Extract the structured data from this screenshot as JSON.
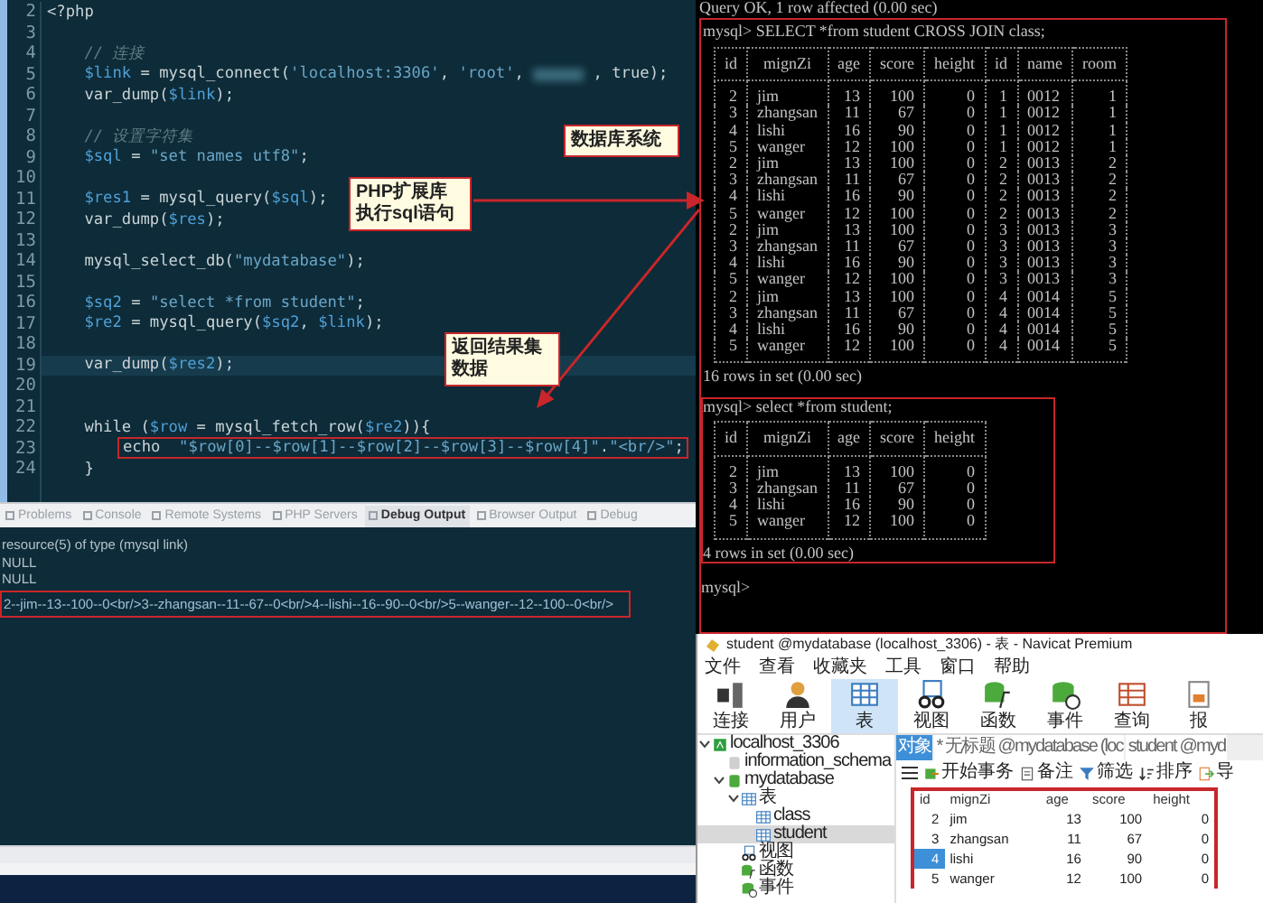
{
  "editor": {
    "lines": [
      {
        "number": "2",
        "current": false,
        "highlighted": false,
        "kind": "code",
        "text": "<?php"
      },
      {
        "number": "3",
        "current": false
      },
      {
        "number": "4",
        "current": false,
        "highlighted": false,
        "kind": "comment",
        "text": "    // 连接"
      },
      {
        "number": "5",
        "current": false,
        "highlighted": false,
        "kind": "code",
        "text": "    $link = mysql_connect('localhost:3306', 'root', ",
        "blurred": true,
        "after": " , true);"
      },
      {
        "number": "6",
        "current": false,
        "highlighted": false,
        "kind": "code",
        "text": "    var_dump($link);"
      },
      {
        "number": "7",
        "current": false
      },
      {
        "number": "8",
        "current": false,
        "highlighted": false,
        "kind": "comment",
        "text": "    // 设置字符集"
      },
      {
        "number": "9",
        "current": false,
        "highlighted": false,
        "kind": "code",
        "text": "    $sql = \"set names utf8\";"
      },
      {
        "number": "10",
        "current": false
      },
      {
        "number": "11",
        "current": false,
        "highlighted": false,
        "kind": "code",
        "text": "    $res1 = mysql_query($sql);"
      },
      {
        "number": "12",
        "current": false,
        "highlighted": false,
        "kind": "code",
        "text": "    var_dump($res);"
      },
      {
        "number": "13",
        "current": false
      },
      {
        "number": "14",
        "current": false,
        "highlighted": false,
        "kind": "code",
        "text": "    mysql_select_db(\"mydatabase\");"
      },
      {
        "number": "15",
        "current": false
      },
      {
        "number": "16",
        "current": false,
        "highlighted": false,
        "kind": "code",
        "text": "    $sq2 = \"select *from student\";"
      },
      {
        "number": "17",
        "current": false,
        "highlighted": false,
        "kind": "code",
        "text": "    $re2 = mysql_query($sq2, $link);"
      },
      {
        "number": "18",
        "current": false
      },
      {
        "number": "19",
        "current": true,
        "highlighted": false,
        "kind": "code",
        "text": "    var_dump($res2);"
      },
      {
        "number": "20",
        "current": false
      },
      {
        "number": "21",
        "current": false
      },
      {
        "number": "22",
        "current": false,
        "highlighted": false,
        "kind": "code",
        "text": "    while ($row = mysql_fetch_row($re2)){"
      },
      {
        "number": "23",
        "current": false,
        "highlighted": true,
        "kind": "code",
        "text": "echo  \"$row[0]--$row[1]--$row[2]--$row[3]--$row[4]\".\"<br/>\";"
      },
      {
        "number": "24",
        "current": false,
        "highlighted": false,
        "kind": "code",
        "text": "    }"
      }
    ]
  },
  "callouts": [
    "数据库系统",
    "PHP扩展库执行sql语句",
    "返回结果集数据"
  ],
  "console": {
    "tabs": [
      {
        "label": "Problems",
        "selected": false
      },
      {
        "label": "Console",
        "selected": false
      },
      {
        "label": "Remote Systems",
        "selected": false
      },
      {
        "label": "PHP Servers",
        "selected": false
      },
      {
        "label": "Debug Output",
        "selected": true
      },
      {
        "label": "Browser Output",
        "selected": false
      },
      {
        "label": "Debug",
        "selected": false
      }
    ],
    "lines": [
      {
        "highlighted": false,
        "text": "resource(5) of type (mysql link)"
      },
      {
        "highlighted": false,
        "text": "NULL"
      },
      {
        "highlighted": false,
        "text": "NULL"
      },
      {
        "highlighted": true,
        "text": "2--jim--13--100--0<br/>3--zhangsan--11--67--0<br/>4--lishi--16--90--0<br/>5--wanger--12--100--0<br/>"
      }
    ]
  },
  "terminal": {
    "status": "Query OK, 1 row affected (0.00 sec)",
    "framed": true,
    "queries": [
      {
        "prompt": "mysql> SELECT *from student CROSS JOIN class;",
        "highlighted": false,
        "columns": [
          {
            "label": "id",
            "numeric": true
          },
          {
            "label": "mignZi",
            "numeric": false
          },
          {
            "label": "age",
            "numeric": true
          },
          {
            "label": "score",
            "numeric": true
          },
          {
            "label": "height",
            "numeric": true
          },
          {
            "label": "id",
            "numeric": true
          },
          {
            "label": "name",
            "numeric": false
          },
          {
            "label": "room",
            "numeric": true
          }
        ],
        "rows": [
          [
            "2",
            "jim",
            "13",
            "100",
            "0",
            "1",
            "0012",
            "1"
          ],
          [
            "3",
            "zhangsan",
            "11",
            "67",
            "0",
            "1",
            "0012",
            "1"
          ],
          [
            "4",
            "lishi",
            "16",
            "90",
            "0",
            "1",
            "0012",
            "1"
          ],
          [
            "5",
            "wanger",
            "12",
            "100",
            "0",
            "1",
            "0012",
            "1"
          ],
          [
            "2",
            "jim",
            "13",
            "100",
            "0",
            "2",
            "0013",
            "2"
          ],
          [
            "3",
            "zhangsan",
            "11",
            "67",
            "0",
            "2",
            "0013",
            "2"
          ],
          [
            "4",
            "lishi",
            "16",
            "90",
            "0",
            "2",
            "0013",
            "2"
          ],
          [
            "5",
            "wanger",
            "12",
            "100",
            "0",
            "2",
            "0013",
            "2"
          ],
          [
            "2",
            "jim",
            "13",
            "100",
            "0",
            "3",
            "0013",
            "3"
          ],
          [
            "3",
            "zhangsan",
            "11",
            "67",
            "0",
            "3",
            "0013",
            "3"
          ],
          [
            "4",
            "lishi",
            "16",
            "90",
            "0",
            "3",
            "0013",
            "3"
          ],
          [
            "5",
            "wanger",
            "12",
            "100",
            "0",
            "3",
            "0013",
            "3"
          ],
          [
            "2",
            "jim",
            "13",
            "100",
            "0",
            "4",
            "0014",
            "5"
          ],
          [
            "3",
            "zhangsan",
            "11",
            "67",
            "0",
            "4",
            "0014",
            "5"
          ],
          [
            "4",
            "lishi",
            "16",
            "90",
            "0",
            "4",
            "0014",
            "5"
          ],
          [
            "5",
            "wanger",
            "12",
            "100",
            "0",
            "4",
            "0014",
            "5"
          ]
        ],
        "summary": "16 rows in set (0.00 sec)"
      },
      {
        "prompt": "mysql> select *from student;",
        "highlighted": true,
        "columns": [
          {
            "label": "id",
            "numeric": true
          },
          {
            "label": "mignZi",
            "numeric": false
          },
          {
            "label": "age",
            "numeric": true
          },
          {
            "label": "score",
            "numeric": true
          },
          {
            "label": "height",
            "numeric": true
          }
        ],
        "rows": [
          [
            "2",
            "jim",
            "13",
            "100",
            "0"
          ],
          [
            "3",
            "zhangsan",
            "11",
            "67",
            "0"
          ],
          [
            "4",
            "lishi",
            "16",
            "90",
            "0"
          ],
          [
            "5",
            "wanger",
            "12",
            "100",
            "0"
          ]
        ],
        "summary": "4 rows in set (0.00 sec)"
      }
    ],
    "final_prompt": "mysql>"
  },
  "navicat": {
    "title": "student @mydatabase (localhost_3306) - 表 - Navicat Premium",
    "menu": [
      "文件",
      "查看",
      "收藏夹",
      "工具",
      "窗口",
      "帮助"
    ],
    "toolbar": [
      {
        "label": "连接",
        "kind": "plug",
        "selected": false
      },
      {
        "label": "用户",
        "kind": "user",
        "selected": false
      },
      {
        "label": "表",
        "kind": "table",
        "selected": true
      },
      {
        "label": "视图",
        "kind": "view",
        "selected": false
      },
      {
        "label": "函数",
        "kind": "function",
        "selected": false
      },
      {
        "label": "事件",
        "kind": "event",
        "selected": false
      },
      {
        "label": "查询",
        "kind": "query",
        "selected": false
      },
      {
        "label": "报",
        "kind": "report",
        "selected": false
      }
    ],
    "tree": [
      {
        "label": "localhost_3306",
        "kind": "server",
        "expanded": true,
        "selected": false,
        "children": [
          {
            "label": "information_schema",
            "kind": "db",
            "selected": false
          },
          {
            "label": "mydatabase",
            "kind": "db-open",
            "expanded": true,
            "selected": false,
            "children": [
              {
                "label": "表",
                "kind": "tables",
                "expanded": true,
                "selected": false,
                "children": [
                  {
                    "label": "class",
                    "kind": "table",
                    "selected": false
                  },
                  {
                    "label": "student",
                    "kind": "table",
                    "selected": true
                  }
                ]
              },
              {
                "label": "视图",
                "kind": "view",
                "selected": false
              },
              {
                "label": "函数",
                "kind": "function",
                "selected": false
              },
              {
                "label": "事件",
                "kind": "event",
                "selected": false
              }
            ]
          }
        ]
      }
    ],
    "tabs": [
      {
        "label": "对象",
        "selected": true
      },
      {
        "label": "* 无标题 @mydatabase (loc",
        "selected": false
      },
      {
        "label": "student @myd",
        "selected": false
      }
    ],
    "actions": [
      {
        "label": "开始事务",
        "kind": "transaction"
      },
      {
        "label": "备注",
        "kind": "note"
      },
      {
        "label": "筛选",
        "kind": "filter"
      },
      {
        "label": "排序",
        "kind": "sort"
      },
      {
        "label": "导",
        "kind": "export"
      }
    ],
    "grid": {
      "columns": [
        {
          "label": "id",
          "numeric": true
        },
        {
          "label": "mignZi",
          "numeric": false
        },
        {
          "label": "age",
          "numeric": true
        },
        {
          "label": "score",
          "numeric": true
        },
        {
          "label": "height",
          "numeric": true
        }
      ],
      "rows": [
        {
          "cells": [
            "2",
            "jim",
            "13",
            "100",
            "0"
          ],
          "selected": false
        },
        {
          "cells": [
            "3",
            "zhangsan",
            "11",
            "67",
            "0"
          ],
          "selected": false
        },
        {
          "cells": [
            "4",
            "lishi",
            "16",
            "90",
            "0"
          ],
          "selected": true
        },
        {
          "cells": [
            "5",
            "wanger",
            "12",
            "100",
            "0"
          ],
          "selected": false
        }
      ]
    }
  }
}
